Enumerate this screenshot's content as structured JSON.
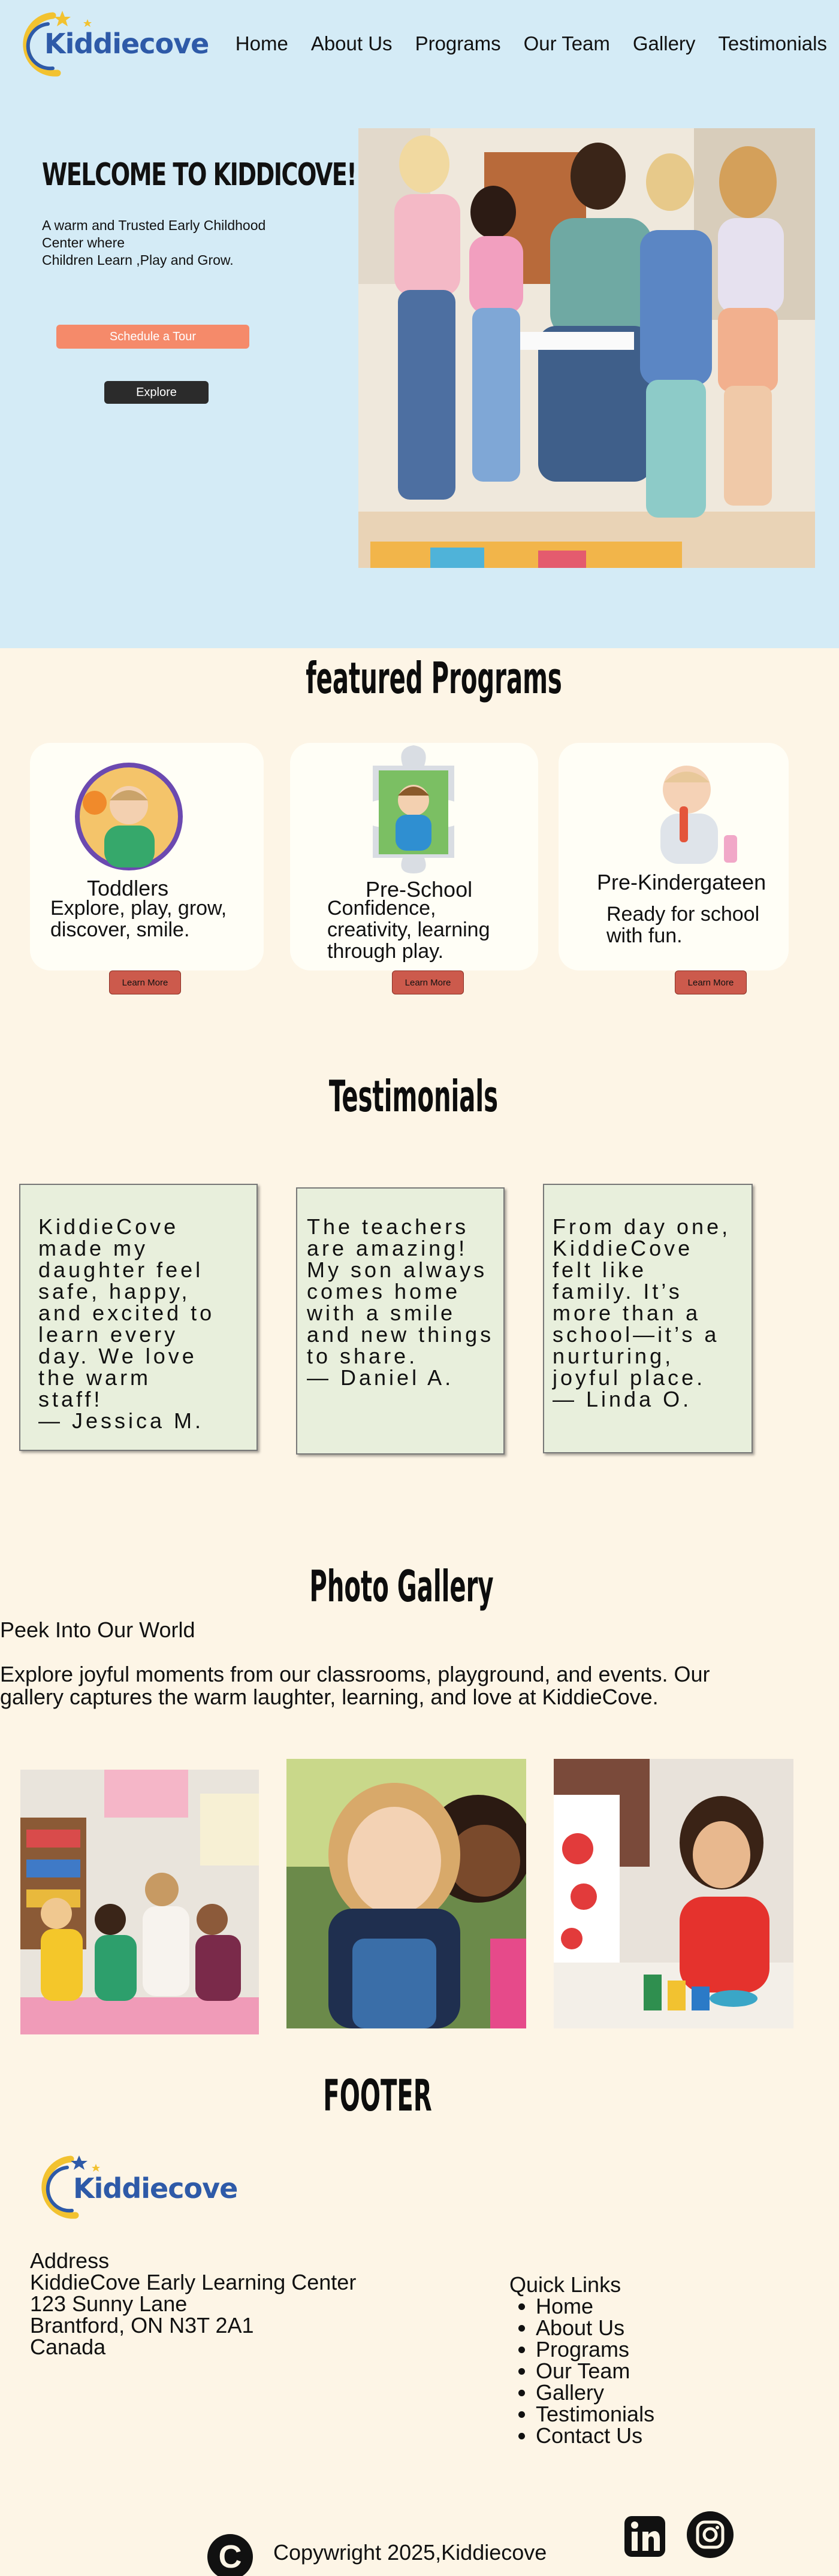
{
  "brand": {
    "name": "Kiddiecove"
  },
  "nav": [
    "Home",
    "About Us",
    "Programs",
    "Our Team",
    "Gallery",
    "Testimonials"
  ],
  "hero": {
    "title": "WELCOME TO KIDDICOVE!",
    "subtitle_lines": [
      "A warm and Trusted Early Childhood",
      "Center where",
      "Children Learn ,Play and Grow."
    ],
    "tour_button": "Schedule a Tour",
    "explore_button": "Explore"
  },
  "programs": {
    "title": "featured Programs",
    "items": [
      {
        "name": "Toddlers",
        "desc_lines": [
          "Explore, play, grow,",
          "discover, smile."
        ],
        "button": "Learn More"
      },
      {
        "name": "Pre-School",
        "desc_lines": [
          "Confidence,",
          "creativity, learning",
          "through play."
        ],
        "button": "Learn More"
      },
      {
        "name": "Pre-Kindergateen",
        "desc_lines": [
          "Ready for school",
          "with fun."
        ],
        "button": "Learn More"
      }
    ]
  },
  "testimonials": {
    "title": "Testimonials",
    "items": [
      {
        "lines": [
          "KiddieCove",
          "made my",
          "daughter feel",
          "safe, happy,",
          "and excited to",
          "learn every",
          "day. We love",
          "the warm",
          "staff!",
          " — Jessica M."
        ]
      },
      {
        "lines": [
          "The teachers",
          "are amazing!",
          "My son always",
          "comes home",
          "with a smile",
          "and new things",
          "to share.",
          " — Daniel A."
        ]
      },
      {
        "lines": [
          "From day one,",
          "KiddieCove",
          "felt like",
          "family. It’s",
          "more than a",
          "school—it’s a",
          "nurturing,",
          "joyful place.",
          " — Linda O."
        ]
      }
    ]
  },
  "gallery": {
    "title": "Photo Gallery",
    "heading": "Peek Into Our World",
    "text": "Explore joyful moments from our classrooms, playground, and events. Our gallery captures the warm laughter, learning, and love at KiddieCove."
  },
  "footer": {
    "title": "FOOTER",
    "address_lines": [
      "Address",
      "KiddieCove Early Learning Center",
      "123 Sunny Lane",
      "Brantford, ON N3T 2A1",
      "Canada"
    ],
    "quick_title": "Quick Links",
    "quick_links": [
      "Home",
      "About Us",
      "Programs",
      "Our Team",
      "Gallery",
      "Testimonials",
      "Contact Us"
    ],
    "copyright_symbol": "C",
    "copyright": "Copywright 2025,Kiddiecove",
    "social": [
      "linkedin-icon",
      "instagram-icon"
    ]
  },
  "colors": {
    "hero_bg": "#d4ebf6",
    "page_bg": "#fdf5e6",
    "tour_button": "#f58a6a",
    "learn_button": "#cc5a4c",
    "testimonial_card": "#e8efdc",
    "brand_blue": "#2e5aa8",
    "brand_yellow": "#f2c230"
  }
}
